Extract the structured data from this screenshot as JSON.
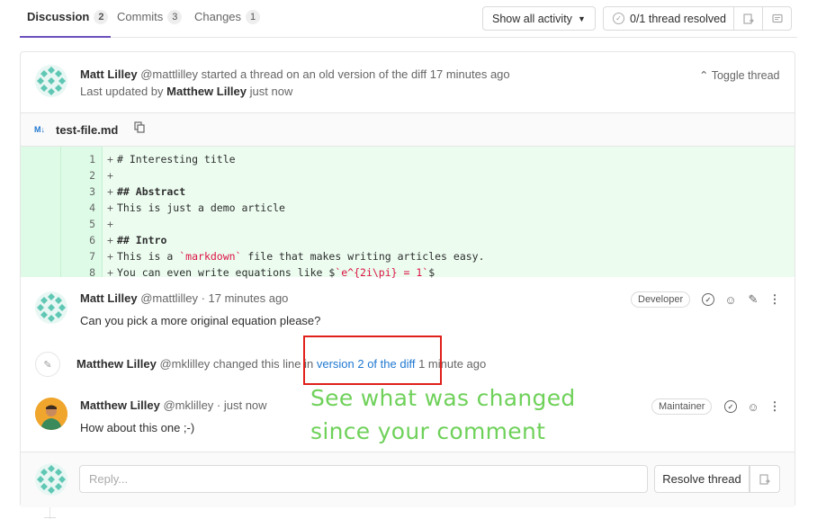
{
  "tabs": [
    {
      "label": "Discussion",
      "count": "2"
    },
    {
      "label": "Commits",
      "count": "3"
    },
    {
      "label": "Changes",
      "count": "1"
    }
  ],
  "toolbar": {
    "activity_label": "Show all activity",
    "resolved_label": "0/1 thread resolved"
  },
  "thread": {
    "author": "Matt Lilley",
    "handle": "@mattlilley",
    "started_text": "started a thread on an old version of the diff 17 minutes ago",
    "updated_prefix": "Last updated by",
    "updated_by": "Matthew Lilley",
    "updated_when": "just now",
    "toggle_label": "Toggle thread"
  },
  "file": {
    "icon_label": "M↓",
    "name": "test-file.md"
  },
  "diff": {
    "lines": [
      {
        "num": "1",
        "text": "# Interesting title"
      },
      {
        "num": "2",
        "text": ""
      },
      {
        "num": "3",
        "text": "## Abstract"
      },
      {
        "num": "4",
        "text": "This is just a demo article"
      },
      {
        "num": "5",
        "text": ""
      },
      {
        "num": "6",
        "text": "## Intro"
      },
      {
        "num": "7",
        "pre": "This is a ",
        "hl": "`markdown`",
        "post": " file that makes writing articles easy."
      },
      {
        "num": "8",
        "pre": "You can even write equations like $",
        "hl": "`e^{2i\\pi} = 1`",
        "post": "$"
      }
    ],
    "plus": "+"
  },
  "comment1": {
    "author": "Matt Lilley",
    "meta": "@mattlilley · 17 minutes ago",
    "role": "Developer",
    "text": "Can you pick a more original equation please?"
  },
  "system_note": {
    "author": "Matthew Lilley",
    "prefix": "@mklilley changed this line in",
    "link": "version 2 of the diff",
    "suffix": "1 minute ago"
  },
  "comment2": {
    "author": "Matthew Lilley",
    "meta": "@mklilley · just now",
    "role": "Maintainer",
    "text": "How about this one ;-)"
  },
  "annotation": {
    "text": "See what was changed since your comment",
    "color": "#6fd15a",
    "box_color": "#e0201b"
  },
  "reply": {
    "placeholder": "Reply...",
    "resolve_label": "Resolve thread"
  }
}
